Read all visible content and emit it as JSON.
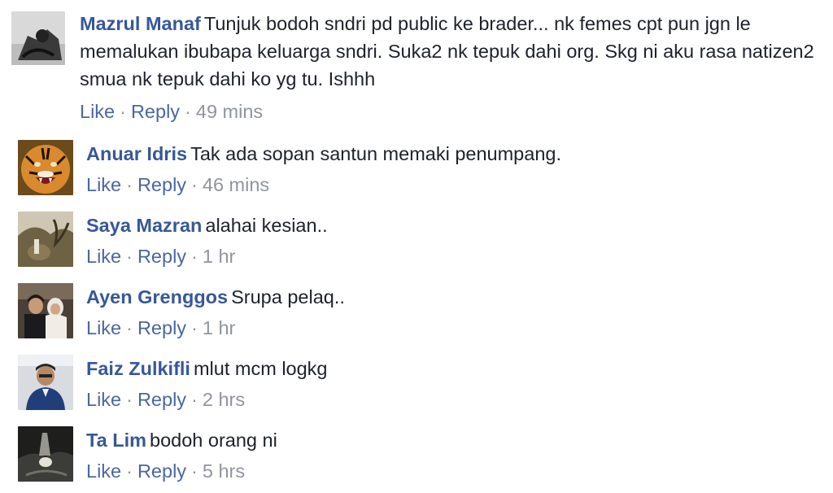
{
  "comments": [
    {
      "author": "Mazrul Manaf",
      "text": "Tunjuk bodoh sndri pd public ke brader... nk femes cpt pun jgn le memalukan ibubapa keluarga sndri. Suka2 nk tepuk dahi org. Skg ni aku rasa natizen2 smua nk tepuk dahi ko yg tu. Ishhh",
      "like": "Like",
      "reply": "Reply",
      "sep": "·",
      "time": "49 mins",
      "avatar_icon": "profile-photo"
    },
    {
      "author": "Anuar Idris",
      "text": "Tak ada sopan santun memaki penumpang.",
      "like": "Like",
      "reply": "Reply",
      "sep": "·",
      "time": "46 mins",
      "avatar_icon": "tiger-photo"
    },
    {
      "author": "Saya Mazran",
      "text": "alahai kesian..",
      "like": "Like",
      "reply": "Reply",
      "sep": "·",
      "time": "1 hr",
      "avatar_icon": "landscape-photo"
    },
    {
      "author": "Ayen Grenggos",
      "text": "Srupa pelaq..",
      "like": "Like",
      "reply": "Reply",
      "sep": "·",
      "time": "1 hr",
      "avatar_icon": "couple-photo"
    },
    {
      "author": "Faiz Zulkifli",
      "text": "mlut mcm logkg",
      "like": "Like",
      "reply": "Reply",
      "sep": "·",
      "time": "2 hrs",
      "avatar_icon": "man-photo"
    },
    {
      "author": "Ta Lim",
      "text": "bodoh orang ni",
      "like": "Like",
      "reply": "Reply",
      "sep": "·",
      "time": "5 hrs",
      "avatar_icon": "dark-photo"
    }
  ],
  "colors": {
    "author": "#365899",
    "action_link": "#4b67a1",
    "meta": "#90949c",
    "text": "#1d2129"
  }
}
